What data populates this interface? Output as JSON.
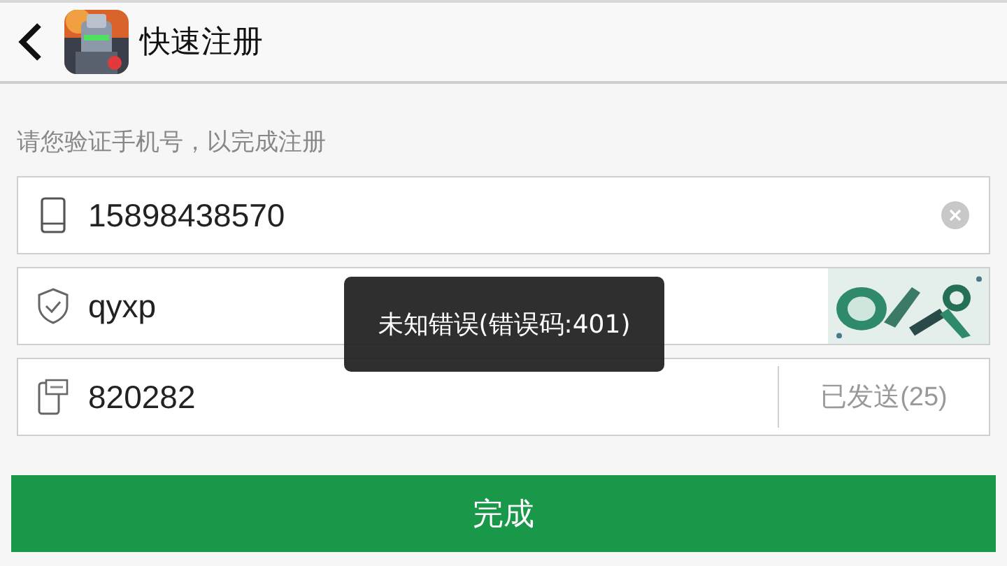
{
  "header": {
    "title": "快速注册"
  },
  "hint": "请您验证手机号，以完成注册",
  "fields": [
    {
      "kind": "phone",
      "value": "15898438570",
      "clearable": true
    },
    {
      "kind": "captcha",
      "value": "qyxp"
    },
    {
      "kind": "sms",
      "value": "820282",
      "countdown": "已发送(25)"
    }
  ],
  "toast": "未知错误(错误码:401)",
  "submit_button": "完成"
}
